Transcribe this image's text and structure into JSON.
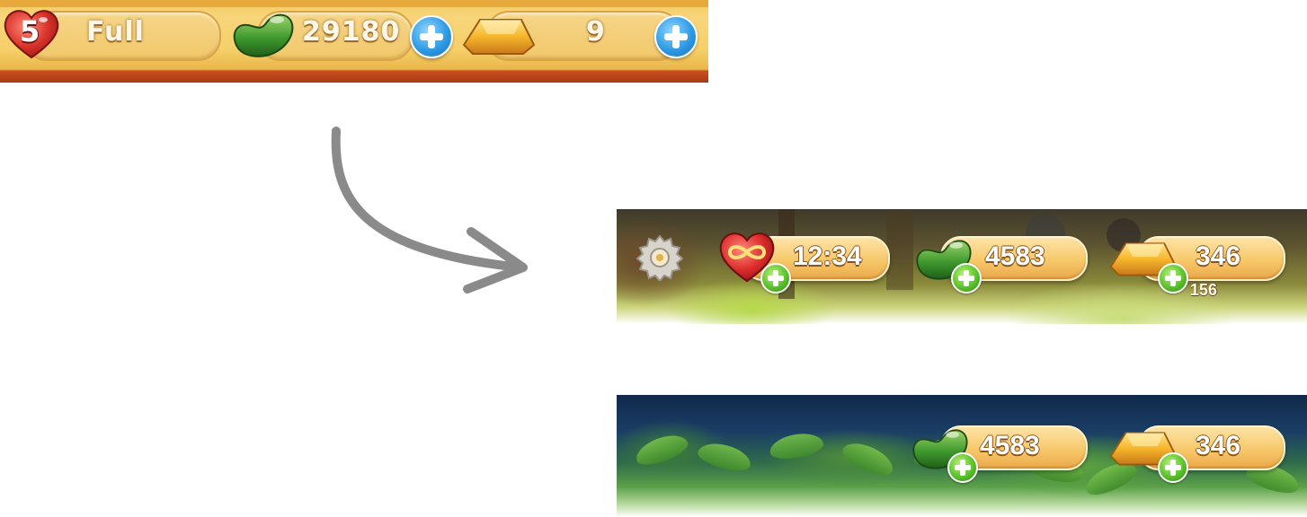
{
  "old_bar": {
    "lives_count": "5",
    "lives_status": "Full",
    "beans": "29180",
    "gold": "9",
    "icons": [
      "heart-icon",
      "green-bean-icon",
      "add-beans-button",
      "gold-bar-icon",
      "add-gold-button"
    ],
    "colors": {
      "bar_yellow": "#f6d06a",
      "bar_red": "#a83a16",
      "plus_blue": "#2f9be6"
    }
  },
  "arrow": {
    "icon": "curved-arrow-icon",
    "color": "#8a8a8a"
  },
  "new_bar_forest": {
    "lives_timer": "12:34",
    "beans": "4583",
    "gold": "346",
    "background_number": "156",
    "icons": [
      "gear-icon",
      "infinity-heart-icon",
      "green-bean-icon",
      "gold-bar-icon",
      "green-plus-icon"
    ]
  },
  "new_bar_night": {
    "beans": "4583",
    "gold": "346",
    "icons": [
      "green-bean-icon",
      "gold-bar-icon",
      "green-plus-icon"
    ]
  }
}
